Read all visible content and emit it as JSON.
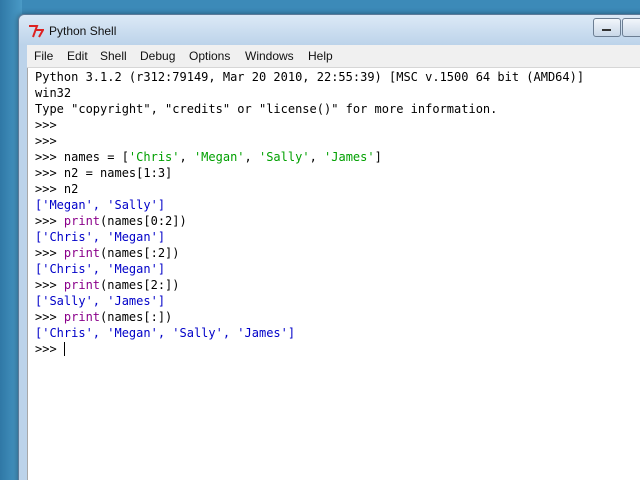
{
  "window": {
    "title": "Python Shell"
  },
  "menu": [
    "File",
    "Edit",
    "Shell",
    "Debug",
    "Options",
    "Windows",
    "Help"
  ],
  "shell": {
    "lines": [
      {
        "segments": [
          {
            "text": "Python 3.1.2 (r312:79149, Mar 20 2010, 22:55:39) [MSC v.1500 64 bit (AMD64)]",
            "kind": "black"
          }
        ]
      },
      {
        "segments": [
          {
            "text": "win32",
            "kind": "black"
          }
        ]
      },
      {
        "segments": [
          {
            "text": "Type \"copyright\", \"credits\" or \"license()\" for more information.",
            "kind": "black"
          }
        ]
      },
      {
        "segments": [
          {
            "text": ">>> ",
            "kind": "black"
          }
        ]
      },
      {
        "segments": [
          {
            "text": ">>> ",
            "kind": "black"
          }
        ]
      },
      {
        "segments": [
          {
            "text": ">>> names = [",
            "kind": "black"
          },
          {
            "text": "'Chris'",
            "kind": "green"
          },
          {
            "text": ", ",
            "kind": "black"
          },
          {
            "text": "'Megan'",
            "kind": "green"
          },
          {
            "text": ", ",
            "kind": "black"
          },
          {
            "text": "'Sally'",
            "kind": "green"
          },
          {
            "text": ", ",
            "kind": "black"
          },
          {
            "text": "'James'",
            "kind": "green"
          },
          {
            "text": "]",
            "kind": "black"
          }
        ]
      },
      {
        "segments": [
          {
            "text": ">>> n2 = names[1:3]",
            "kind": "black"
          }
        ]
      },
      {
        "segments": [
          {
            "text": ">>> n2",
            "kind": "black"
          }
        ]
      },
      {
        "segments": [
          {
            "text": "['Megan', 'Sally']",
            "kind": "blue"
          }
        ]
      },
      {
        "segments": [
          {
            "text": ">>> ",
            "kind": "black"
          },
          {
            "text": "print",
            "kind": "purple"
          },
          {
            "text": "(names[0:2])",
            "kind": "black"
          }
        ]
      },
      {
        "segments": [
          {
            "text": "['Chris', 'Megan']",
            "kind": "blue"
          }
        ]
      },
      {
        "segments": [
          {
            "text": ">>> ",
            "kind": "black"
          },
          {
            "text": "print",
            "kind": "purple"
          },
          {
            "text": "(names[:2])",
            "kind": "black"
          }
        ]
      },
      {
        "segments": [
          {
            "text": "['Chris', 'Megan']",
            "kind": "blue"
          }
        ]
      },
      {
        "segments": [
          {
            "text": ">>> ",
            "kind": "black"
          },
          {
            "text": "print",
            "kind": "purple"
          },
          {
            "text": "(names[2:])",
            "kind": "black"
          }
        ]
      },
      {
        "segments": [
          {
            "text": "['Sally', 'James']",
            "kind": "blue"
          }
        ]
      },
      {
        "segments": [
          {
            "text": ">>> ",
            "kind": "black"
          },
          {
            "text": "print",
            "kind": "purple"
          },
          {
            "text": "(names[:])",
            "kind": "black"
          }
        ]
      },
      {
        "segments": [
          {
            "text": "['Chris', 'Megan', 'Sally', 'James']",
            "kind": "blue"
          }
        ]
      },
      {
        "segments": [
          {
            "text": ">>> ",
            "kind": "black"
          }
        ]
      }
    ]
  }
}
